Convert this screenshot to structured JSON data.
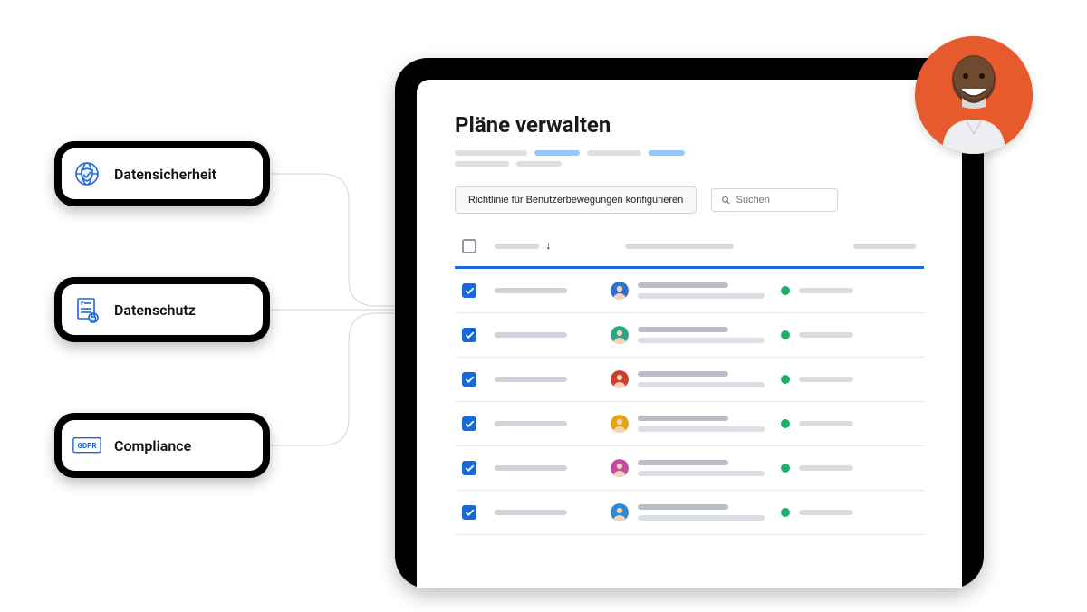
{
  "pills": {
    "security": {
      "label": "Datensicherheit"
    },
    "privacy": {
      "label": "Datenschutz"
    },
    "compliance": {
      "label": "Compliance"
    }
  },
  "gdpr_badge_text": "GDPR",
  "page": {
    "title": "Pläne verwalten",
    "config_button": "Richtlinie für Benutzerbewegungen konfigurieren",
    "search_placeholder": "Suchen"
  },
  "colors": {
    "accent": "#1868db",
    "status_green": "#1eaf6a",
    "hero_bg": "#e65a2e"
  },
  "row_avatar_colors": [
    "#2f6fd1",
    "#2aa58a",
    "#d13a2f",
    "#e5a614",
    "#c24da0",
    "#2f88d1"
  ],
  "rows_count": 6
}
